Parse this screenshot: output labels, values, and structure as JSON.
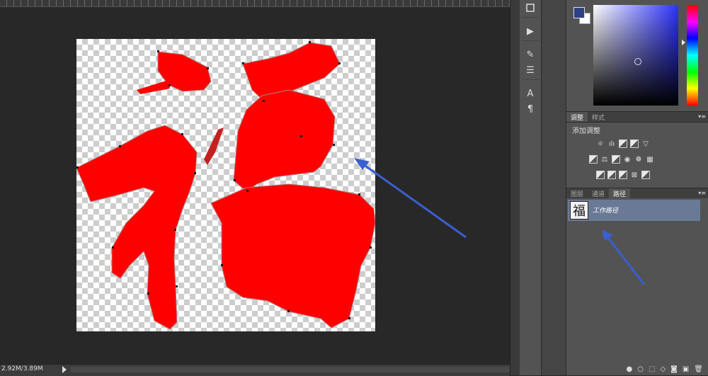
{
  "status": {
    "doc_size": "2.92M/3.89M"
  },
  "tools": [
    {
      "name": "play-icon",
      "glyph": "▶"
    },
    {
      "name": "brush-tool-icon",
      "glyph": "✎"
    },
    {
      "name": "tool-presets-icon",
      "glyph": "☰"
    },
    {
      "name": "character-icon",
      "glyph": "A"
    },
    {
      "name": "paragraph-icon",
      "glyph": "¶"
    }
  ],
  "color_panel": {
    "foreground": "#2e3f86",
    "background": "#ffffff"
  },
  "adjustments": {
    "tabs": [
      "调整",
      "样式"
    ],
    "title": "添加调整",
    "rows": [
      [
        "brightness-icon",
        "levels-icon",
        "curves-icon",
        "exposure-icon",
        "vibrance-icon"
      ],
      [
        "hue-sat-icon",
        "color-balance-icon",
        "bw-icon",
        "photo-filter-icon",
        "channel-mixer-icon",
        "color-lookup-icon"
      ],
      [
        "invert-icon",
        "posterize-icon",
        "threshold-icon",
        "selective-color-icon",
        "gradient-map-icon"
      ]
    ]
  },
  "layers_tabs": [
    "图层",
    "通道",
    "路径"
  ],
  "paths": [
    {
      "label": "工作路径"
    }
  ],
  "canvas": {
    "glyph": "福",
    "glyph_color": "#ff0000",
    "arrow_color": "#3a5fcf"
  }
}
